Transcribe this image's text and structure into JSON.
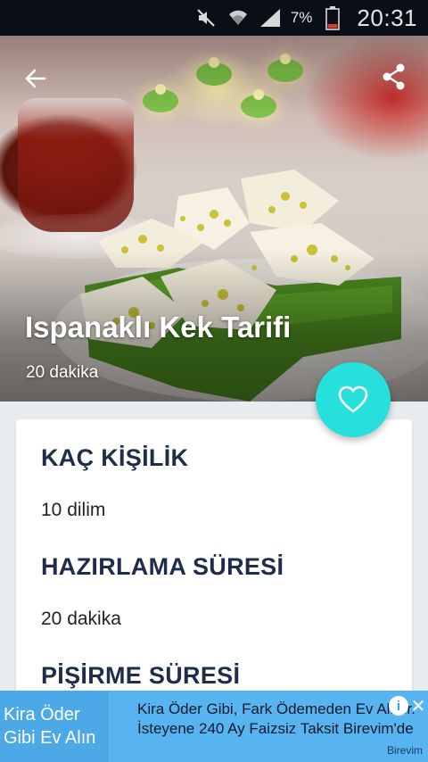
{
  "status_bar": {
    "battery_percent": "7%",
    "time": "20:31",
    "icons": [
      "mute-icon",
      "wifi-icon",
      "signal-icon",
      "battery-icon"
    ]
  },
  "hero": {
    "title": "Ispanaklı Kek Tarifi",
    "time": "20 dakika",
    "back_icon": "arrow-left-icon",
    "share_icon": "share-icon"
  },
  "fab": {
    "icon": "heart-outline-icon",
    "color": "#27e0dc"
  },
  "details": [
    {
      "title": "KAÇ KİŞİLİK",
      "value": "10 dilim"
    },
    {
      "title": "HAZIRLAMA SÜRESİ",
      "value": "20 dakika"
    },
    {
      "title": "PİŞİRME SÜRESİ",
      "value": ""
    }
  ],
  "ad": {
    "left_text_line1": "Kira Öder",
    "left_text_line2": "Gibi Ev Alın",
    "line1": "Kira Öder Gibi, Fark Ödemeden Ev Alınır.",
    "line2": "İsteyene 240 Ay Faizsiz Taksit Birevim'de",
    "brand": "Birevim",
    "background": "#58b4f0"
  }
}
